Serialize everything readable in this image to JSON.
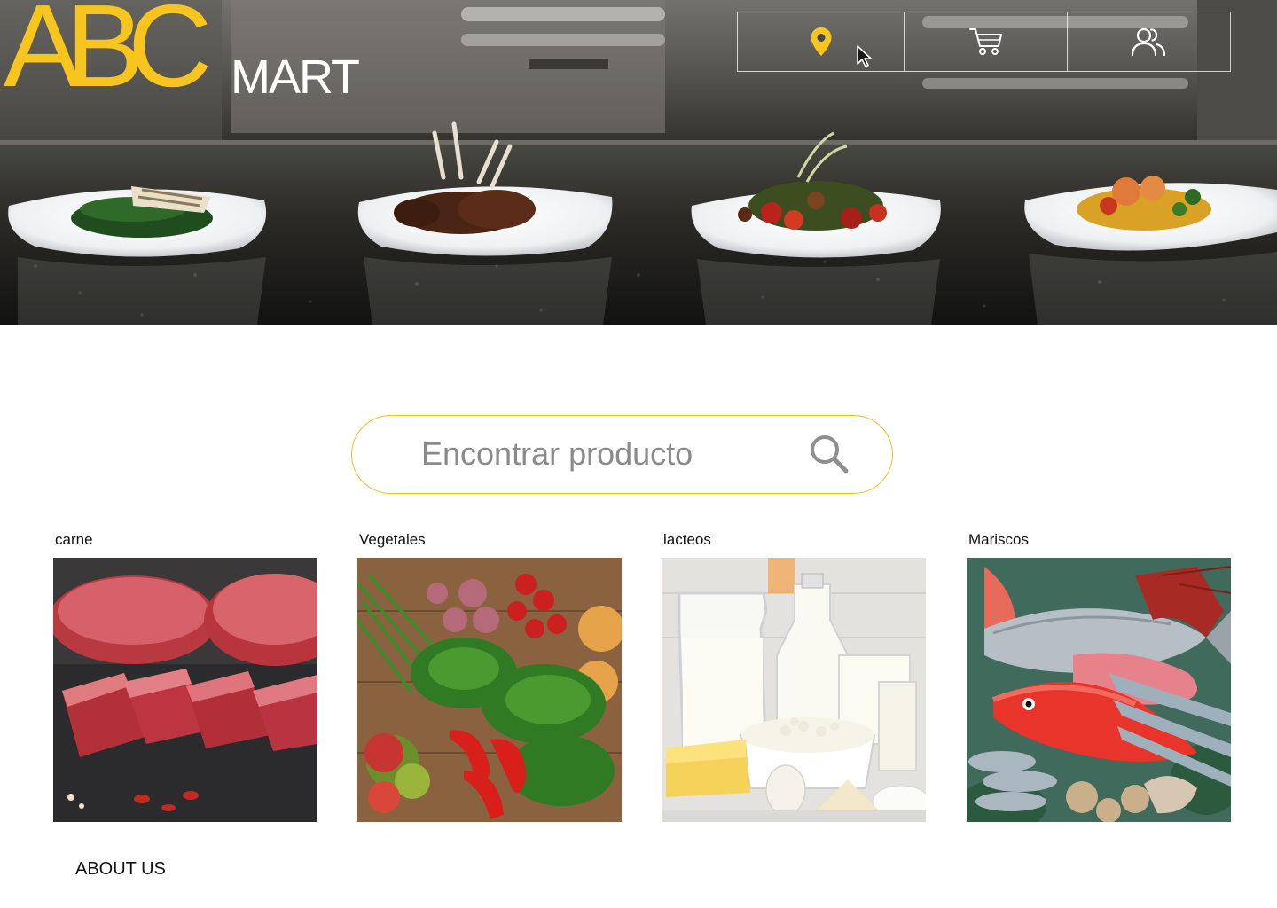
{
  "brand": {
    "logo_abc": "ABC",
    "logo_mart": "MART",
    "accent_color": "#f7c51e"
  },
  "header": {
    "nav": [
      {
        "icon": "location-pin-icon"
      },
      {
        "icon": "shopping-cart-icon"
      },
      {
        "icon": "users-icon"
      }
    ]
  },
  "search": {
    "placeholder": "Encontrar producto",
    "icon": "search-icon",
    "border_color": "#e9c21e"
  },
  "categories": [
    {
      "label": "carne",
      "image": "raw-beef-fillets"
    },
    {
      "label": "Vegetales",
      "image": "assorted-vegetables"
    },
    {
      "label": "lacteos",
      "image": "dairy-products"
    },
    {
      "label": "Mariscos",
      "image": "fresh-seafood"
    }
  ],
  "footer": {
    "about_label": "ABOUT US"
  }
}
